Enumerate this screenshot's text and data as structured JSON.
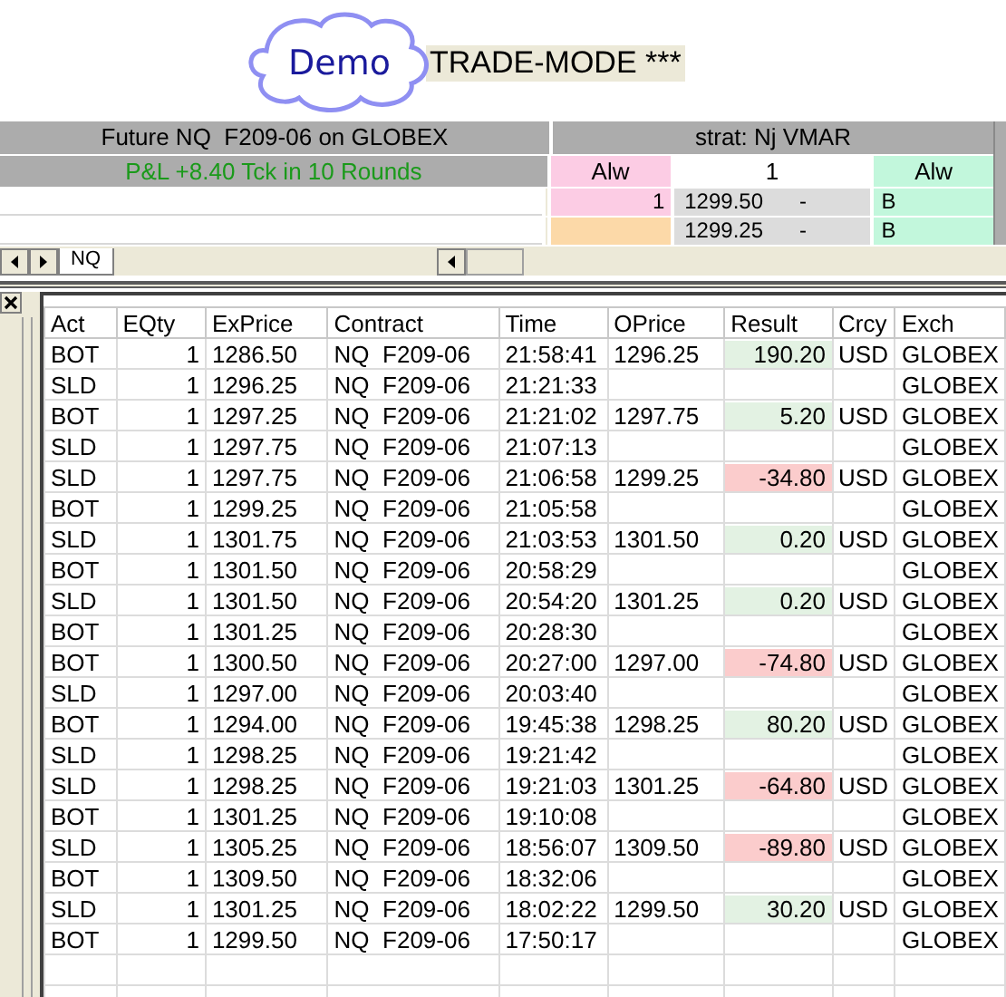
{
  "badge": {
    "label": "Demo"
  },
  "mode_label": "TRADE-MODE ***",
  "sheet": {
    "instrument": "Future NQ  F209-06 on GLOBEX",
    "pnl": "P&L +8.40 Tck in 10 Rounds",
    "strategy": "strat: Nj VMAR",
    "header_cells": [
      {
        "text": "Alw",
        "color": "#fccce4"
      },
      {
        "text": "1",
        "color": "#ffffff"
      },
      {
        "text": "Alw",
        "color": "#c2f7dc"
      }
    ],
    "rows": [
      {
        "qty": {
          "text": "1",
          "color": "#fccce4"
        },
        "price": "1299.50",
        "dash": "-",
        "side": "B"
      },
      {
        "qty": {
          "color": "#fcd9a8"
        },
        "price": "1299.25",
        "dash": "-",
        "side": "B"
      }
    ],
    "tabs": [
      {
        "label": "NQ",
        "selected": true
      }
    ]
  },
  "table": {
    "columns": [
      "Act",
      "EQty",
      "ExPrice",
      "Contract",
      "Time",
      "OPrice",
      "Result",
      "Crcy",
      "Exch"
    ],
    "rows": [
      {
        "act": "BOT",
        "qty": "1",
        "exprice": "1286.50",
        "contract": "NQ  F209-06",
        "time": "21:58:41",
        "oprice": "1296.25",
        "result": {
          "text": "190.20",
          "color": "#e3f2e3"
        },
        "crcy": "USD",
        "exch": "GLOBEX"
      },
      {
        "act": "SLD",
        "qty": "1",
        "exprice": "1296.25",
        "contract": "NQ  F209-06",
        "time": "21:21:33",
        "exch": "GLOBEX"
      },
      {
        "act": "BOT",
        "qty": "1",
        "exprice": "1297.25",
        "contract": "NQ  F209-06",
        "time": "21:21:02",
        "oprice": "1297.75",
        "result": {
          "text": "5.20",
          "color": "#e3f2e3"
        },
        "crcy": "USD",
        "exch": "GLOBEX"
      },
      {
        "act": "SLD",
        "qty": "1",
        "exprice": "1297.75",
        "contract": "NQ  F209-06",
        "time": "21:07:13",
        "exch": "GLOBEX"
      },
      {
        "act": "SLD",
        "qty": "1",
        "exprice": "1297.75",
        "contract": "NQ  F209-06",
        "time": "21:06:58",
        "oprice": "1299.25",
        "result": {
          "text": "-34.80",
          "color": "#fbcccc"
        },
        "crcy": "USD",
        "exch": "GLOBEX"
      },
      {
        "act": "BOT",
        "qty": "1",
        "exprice": "1299.25",
        "contract": "NQ  F209-06",
        "time": "21:05:58",
        "exch": "GLOBEX"
      },
      {
        "act": "SLD",
        "qty": "1",
        "exprice": "1301.75",
        "contract": "NQ  F209-06",
        "time": "21:03:53",
        "oprice": "1301.50",
        "result": {
          "text": "0.20",
          "color": "#e3f2e3"
        },
        "crcy": "USD",
        "exch": "GLOBEX"
      },
      {
        "act": "BOT",
        "qty": "1",
        "exprice": "1301.50",
        "contract": "NQ  F209-06",
        "time": "20:58:29",
        "exch": "GLOBEX"
      },
      {
        "act": "SLD",
        "qty": "1",
        "exprice": "1301.50",
        "contract": "NQ  F209-06",
        "time": "20:54:20",
        "oprice": "1301.25",
        "result": {
          "text": "0.20",
          "color": "#e3f2e3"
        },
        "crcy": "USD",
        "exch": "GLOBEX"
      },
      {
        "act": "BOT",
        "qty": "1",
        "exprice": "1301.25",
        "contract": "NQ  F209-06",
        "time": "20:28:30",
        "exch": "GLOBEX"
      },
      {
        "act": "BOT",
        "qty": "1",
        "exprice": "1300.50",
        "contract": "NQ  F209-06",
        "time": "20:27:00",
        "oprice": "1297.00",
        "result": {
          "text": "-74.80",
          "color": "#fbcccc"
        },
        "crcy": "USD",
        "exch": "GLOBEX"
      },
      {
        "act": "SLD",
        "qty": "1",
        "exprice": "1297.00",
        "contract": "NQ  F209-06",
        "time": "20:03:40",
        "exch": "GLOBEX"
      },
      {
        "act": "BOT",
        "qty": "1",
        "exprice": "1294.00",
        "contract": "NQ  F209-06",
        "time": "19:45:38",
        "oprice": "1298.25",
        "result": {
          "text": "80.20",
          "color": "#e3f2e3"
        },
        "crcy": "USD",
        "exch": "GLOBEX"
      },
      {
        "act": "SLD",
        "qty": "1",
        "exprice": "1298.25",
        "contract": "NQ  F209-06",
        "time": "19:21:42",
        "exch": "GLOBEX"
      },
      {
        "act": "SLD",
        "qty": "1",
        "exprice": "1298.25",
        "contract": "NQ  F209-06",
        "time": "19:21:03",
        "oprice": "1301.25",
        "result": {
          "text": "-64.80",
          "color": "#fbcccc"
        },
        "crcy": "USD",
        "exch": "GLOBEX"
      },
      {
        "act": "BOT",
        "qty": "1",
        "exprice": "1301.25",
        "contract": "NQ  F209-06",
        "time": "19:10:08",
        "exch": "GLOBEX"
      },
      {
        "act": "SLD",
        "qty": "1",
        "exprice": "1305.25",
        "contract": "NQ  F209-06",
        "time": "18:56:07",
        "oprice": "1309.50",
        "result": {
          "text": "-89.80",
          "color": "#fbcccc"
        },
        "crcy": "USD",
        "exch": "GLOBEX"
      },
      {
        "act": "BOT",
        "qty": "1",
        "exprice": "1309.50",
        "contract": "NQ  F209-06",
        "time": "18:32:06",
        "exch": "GLOBEX"
      },
      {
        "act": "SLD",
        "qty": "1",
        "exprice": "1301.25",
        "contract": "NQ  F209-06",
        "time": "18:02:22",
        "oprice": "1299.50",
        "result": {
          "text": "30.20",
          "color": "#e3f2e3"
        },
        "crcy": "USD",
        "exch": "GLOBEX"
      },
      {
        "act": "BOT",
        "qty": "1",
        "exprice": "1299.50",
        "contract": "NQ  F209-06",
        "time": "17:50:17",
        "exch": "GLOBEX"
      }
    ]
  }
}
